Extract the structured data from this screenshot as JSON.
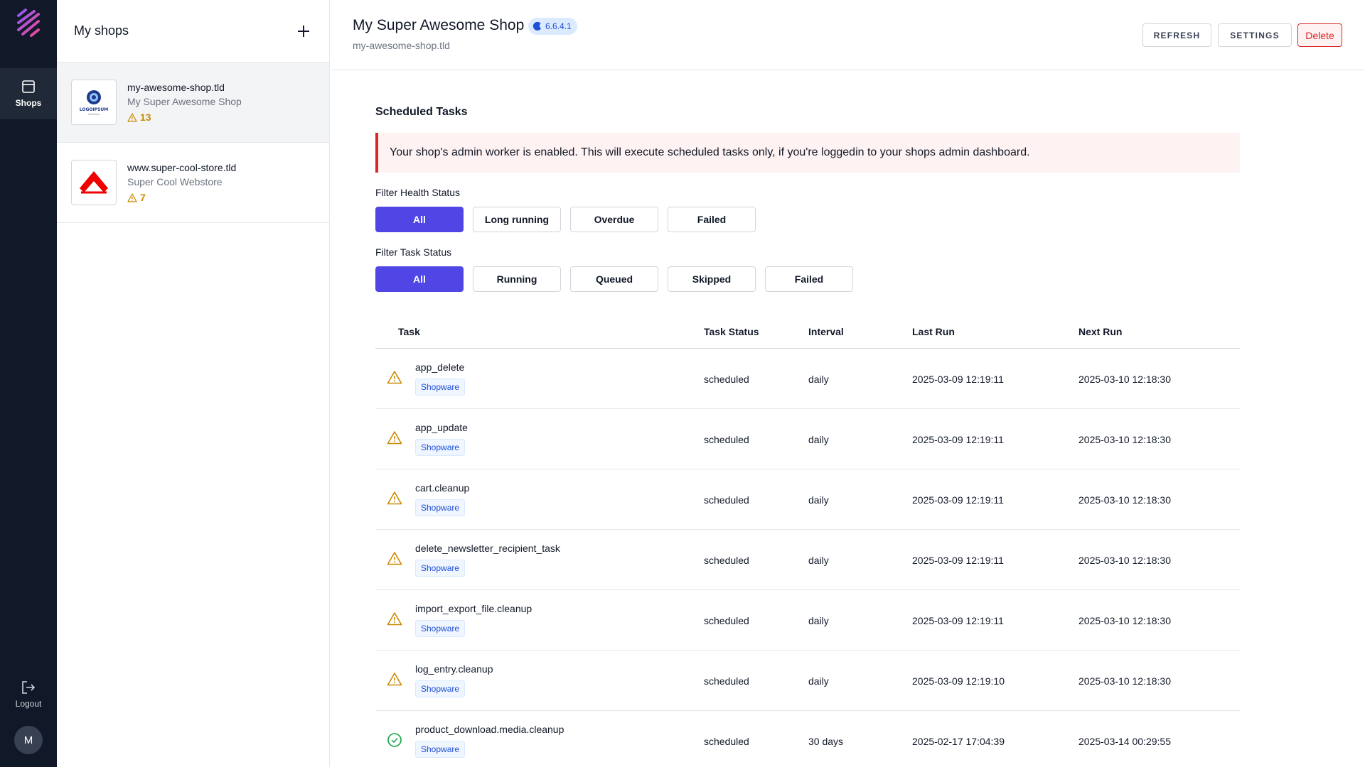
{
  "rail": {
    "nav_label": "Shops",
    "logout_label": "Logout",
    "avatar_initial": "M"
  },
  "shops_panel": {
    "title": "My shops",
    "shops": [
      {
        "domain": "my-awesome-shop.tld",
        "name": "My Super Awesome Shop",
        "warnings": "13",
        "logo_text": "LOGOIPSUM"
      },
      {
        "domain": "www.super-cool-store.tld",
        "name": "Super Cool Webstore",
        "warnings": "7"
      }
    ]
  },
  "header": {
    "title": "My Super Awesome Shop",
    "version": "6.6.4.1",
    "subtitle": "my-awesome-shop.tld",
    "refresh_label": "REFRESH",
    "settings_label": "SETTINGS",
    "delete_label": "Delete"
  },
  "main": {
    "section_title": "Scheduled Tasks",
    "alert": "Your shop's admin worker is enabled. This will execute scheduled tasks only, if you're loggedin to your shops admin dashboard.",
    "health_filter": {
      "label": "Filter Health Status",
      "options": [
        "All",
        "Long running",
        "Overdue",
        "Failed"
      ]
    },
    "task_filter": {
      "label": "Filter Task Status",
      "options": [
        "All",
        "Running",
        "Queued",
        "Skipped",
        "Failed"
      ]
    },
    "table": {
      "headers": {
        "task": "Task",
        "status": "Task Status",
        "interval": "Interval",
        "last_run": "Last Run",
        "next_run": "Next Run"
      },
      "rows": [
        {
          "name": "app_delete",
          "tag": "Shopware",
          "status": "scheduled",
          "interval": "daily",
          "last_run": "2025-03-09 12:19:11",
          "next_run": "2025-03-10 12:18:30",
          "health": "warning"
        },
        {
          "name": "app_update",
          "tag": "Shopware",
          "status": "scheduled",
          "interval": "daily",
          "last_run": "2025-03-09 12:19:11",
          "next_run": "2025-03-10 12:18:30",
          "health": "warning"
        },
        {
          "name": "cart.cleanup",
          "tag": "Shopware",
          "status": "scheduled",
          "interval": "daily",
          "last_run": "2025-03-09 12:19:11",
          "next_run": "2025-03-10 12:18:30",
          "health": "warning"
        },
        {
          "name": "delete_newsletter_recipient_task",
          "tag": "Shopware",
          "status": "scheduled",
          "interval": "daily",
          "last_run": "2025-03-09 12:19:11",
          "next_run": "2025-03-10 12:18:30",
          "health": "warning"
        },
        {
          "name": "import_export_file.cleanup",
          "tag": "Shopware",
          "status": "scheduled",
          "interval": "daily",
          "last_run": "2025-03-09 12:19:11",
          "next_run": "2025-03-10 12:18:30",
          "health": "warning"
        },
        {
          "name": "log_entry.cleanup",
          "tag": "Shopware",
          "status": "scheduled",
          "interval": "daily",
          "last_run": "2025-03-09 12:19:10",
          "next_run": "2025-03-10 12:18:30",
          "health": "warning"
        },
        {
          "name": "product_download.media.cleanup",
          "tag": "Shopware",
          "status": "scheduled",
          "interval": "30 days",
          "last_run": "2025-02-17 17:04:39",
          "next_run": "2025-03-14 00:29:55",
          "health": "ok"
        }
      ]
    }
  },
  "colors": {
    "accent": "#4f46e5",
    "rail_bg": "#111827",
    "warning": "#ca8a04",
    "success": "#16a34a",
    "danger": "#dc2626"
  }
}
